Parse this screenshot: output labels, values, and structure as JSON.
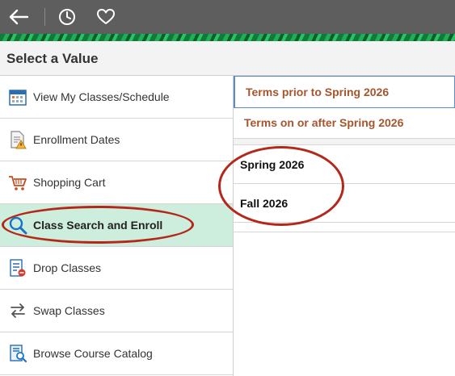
{
  "topbar": {
    "back_icon": "back-arrow-icon",
    "history_icon": "clock-icon",
    "favorites_icon": "heart-icon"
  },
  "header": {
    "title": "Select a Value"
  },
  "nav": {
    "items": [
      {
        "label": "View My Classes/Schedule",
        "icon": "calendar-icon"
      },
      {
        "label": "Enrollment Dates",
        "icon": "document-warning-icon"
      },
      {
        "label": "Shopping Cart",
        "icon": "cart-icon"
      },
      {
        "label": "Class Search and Enroll",
        "icon": "search-icon",
        "selected": true
      },
      {
        "label": "Drop Classes",
        "icon": "drop-list-icon"
      },
      {
        "label": "Swap Classes",
        "icon": "swap-arrows-icon"
      },
      {
        "label": "Browse Course Catalog",
        "icon": "catalog-icon"
      }
    ]
  },
  "terms": {
    "links": [
      "Terms prior to Spring 2026",
      "Terms on or after Spring 2026"
    ],
    "options": [
      "Spring 2026",
      "Fall 2026"
    ]
  },
  "colors": {
    "topbar": "#5e5e5e",
    "selected_bg": "#cdeedd",
    "link": "#a6552d",
    "annotation": "#b3281b"
  }
}
